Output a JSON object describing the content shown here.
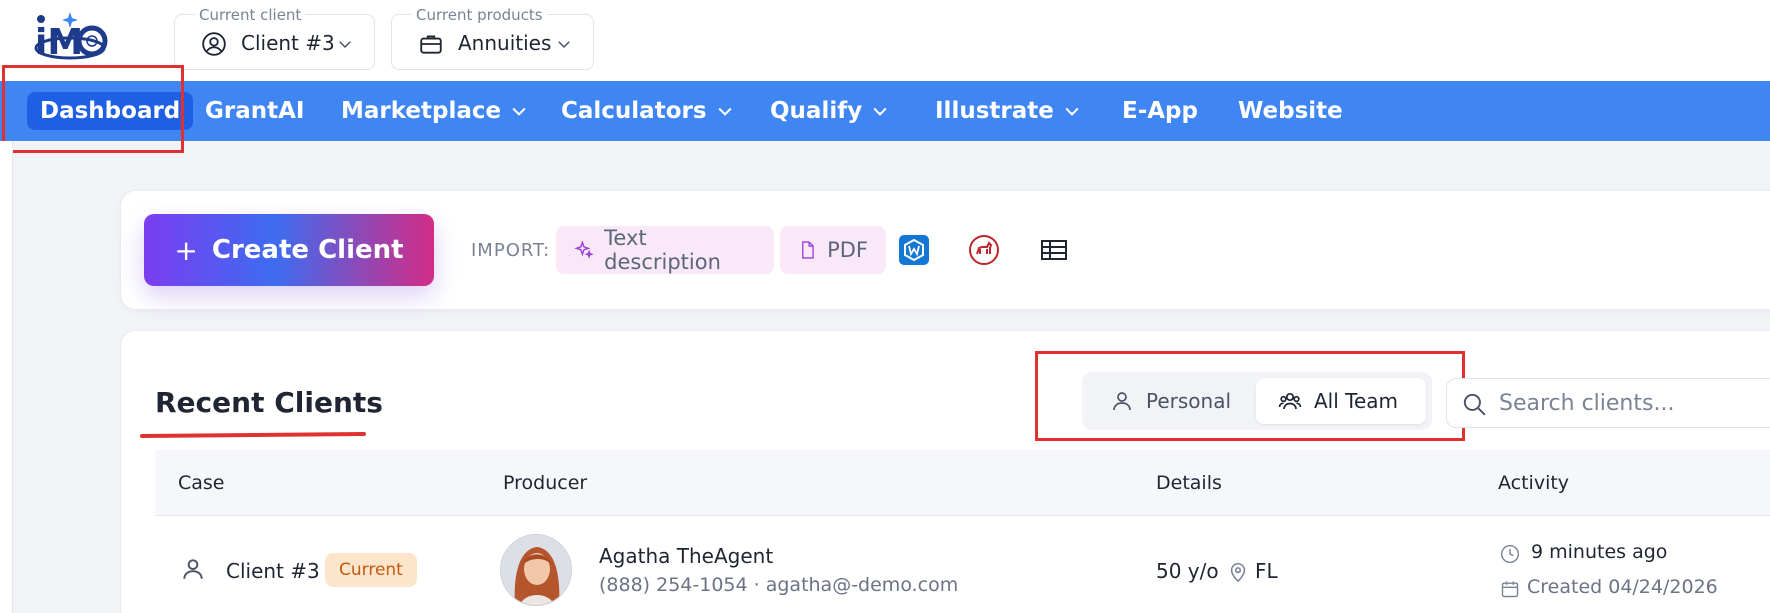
{
  "header": {
    "logo_text": "iMO",
    "client_picker": {
      "caption": "Current client",
      "value": "Client #3",
      "icon": "user-circle-icon"
    },
    "products_picker": {
      "caption": "Current products",
      "value": "Annuities",
      "icon": "briefcase-icon"
    }
  },
  "nav": {
    "items": [
      {
        "label": "Dashboard",
        "active": true
      },
      {
        "label": "GrantAI"
      },
      {
        "label": "Marketplace",
        "dropdown": true
      },
      {
        "label": "Calculators",
        "dropdown": true
      },
      {
        "label": "Qualify",
        "dropdown": true
      },
      {
        "label": "Illustrate",
        "dropdown": true
      },
      {
        "label": "E-App"
      },
      {
        "label": "Website"
      }
    ]
  },
  "create": {
    "button_label": "Create Client",
    "import_label": "IMPORT:",
    "text_chip": "Text description",
    "pdf_chip": "PDF",
    "import_icons": [
      "wealthbox-icon",
      "redtail-dog-icon",
      "spreadsheet-icon"
    ]
  },
  "recent": {
    "title": "Recent Clients",
    "toggle": {
      "personal": "Personal",
      "team": "All Team",
      "selected": "All Team"
    },
    "search_placeholder": "Search clients...",
    "columns": [
      "Case",
      "Producer",
      "Details",
      "Activity"
    ],
    "rows": [
      {
        "case": "Client #3",
        "badge": "Current",
        "producer_name": "Agatha TheAgent",
        "producer_contact": "(888) 254-1054 · agatha@-demo.com",
        "age": "50 y/o",
        "state": "FL",
        "activity": "9 minutes ago",
        "created": "Created 04/24/2026"
      }
    ]
  },
  "colors": {
    "nav_bg": "#3f86f2",
    "nav_active": "#1e5fe4",
    "highlight": "#e03131",
    "badge_bg": "#fde5cc",
    "badge_text": "#c25a12"
  }
}
